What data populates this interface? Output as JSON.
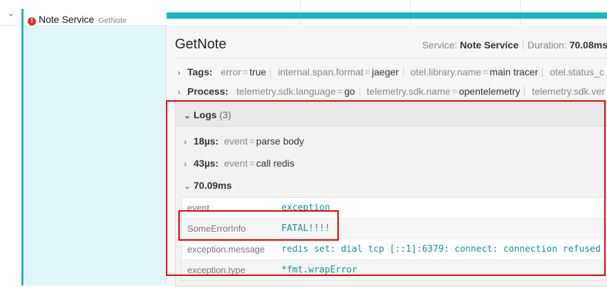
{
  "span": {
    "service": "Note Service",
    "operation": "GetNote"
  },
  "detail": {
    "title": "GetNote",
    "service_label": "Service:",
    "service_value": "Note Service",
    "duration_label": "Duration:",
    "duration_value": "70.08ms",
    "tags_label": "Tags:",
    "tags": [
      {
        "key": "error",
        "value": "true"
      },
      {
        "key": "internal.span.format",
        "value": "jaeger"
      },
      {
        "key": "otel.library.name",
        "value": "main tracer"
      },
      {
        "key": "otel.status_c",
        "value": ""
      }
    ],
    "process_label": "Process:",
    "process": [
      {
        "key": "telemetry.sdk.language",
        "value": "go"
      },
      {
        "key": "telemetry.sdk.name",
        "value": "opentelemetry"
      },
      {
        "key": "telemetry.sdk.ver",
        "value": ""
      }
    ]
  },
  "logs": {
    "label": "Logs",
    "count": "(3)",
    "entries": [
      {
        "time": "18µs:",
        "key": "event",
        "value": "parse body"
      },
      {
        "time": "43µs:",
        "key": "event",
        "value": "call redis"
      },
      {
        "time": "70.09ms"
      }
    ],
    "expanded_fields": [
      {
        "key": "event",
        "value": "exception"
      },
      {
        "key": "SomeErrorInfo",
        "value": "FATAL!!!!"
      },
      {
        "key": "exception.message",
        "value": "redis set: dial tcp [::1]:6379: connect: connection refused"
      },
      {
        "key": "exception.type",
        "value": "*fmt.wrapError"
      }
    ]
  },
  "colors": {
    "accent": "#17b8be",
    "error": "#e03131",
    "highlight": "#e00000"
  }
}
